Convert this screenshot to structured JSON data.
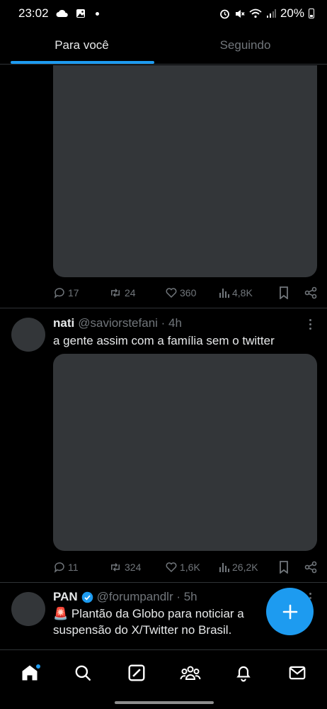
{
  "status_bar": {
    "time": "23:02",
    "battery": "20%",
    "icons": [
      "cloud-icon",
      "gallery-icon",
      "dot-icon",
      "alarm-icon",
      "mute-icon",
      "wifi-icon",
      "signal-icon",
      "battery-icon"
    ]
  },
  "tabs": [
    {
      "label": "Para você",
      "active": true
    },
    {
      "label": "Seguindo",
      "active": false
    }
  ],
  "posts": [
    {
      "stats": {
        "replies": "17",
        "reposts": "24",
        "likes": "360",
        "views": "4,8K"
      }
    },
    {
      "name": "nati",
      "handle": "@saviorstefani · 4h",
      "text": "a gente assim com a família sem o twitter",
      "stats": {
        "replies": "11",
        "reposts": "324",
        "likes": "1,6K",
        "views": "26,2K"
      }
    },
    {
      "name": "PAN",
      "verified": true,
      "handle": "@forumpandlr · 5h",
      "text_line1": "Plantão da Globo para noticiar a",
      "text_line2": "suspensão do X/Twitter no Brasil.",
      "emoji": "🚨"
    }
  ],
  "bottom_nav": [
    "home-icon",
    "search-icon",
    "grok-icon",
    "communities-icon",
    "notifications-icon",
    "messages-icon"
  ],
  "colors": {
    "accent": "#1d9bf0",
    "background": "#000000",
    "muted": "#71767b",
    "media_placeholder": "#333639"
  }
}
